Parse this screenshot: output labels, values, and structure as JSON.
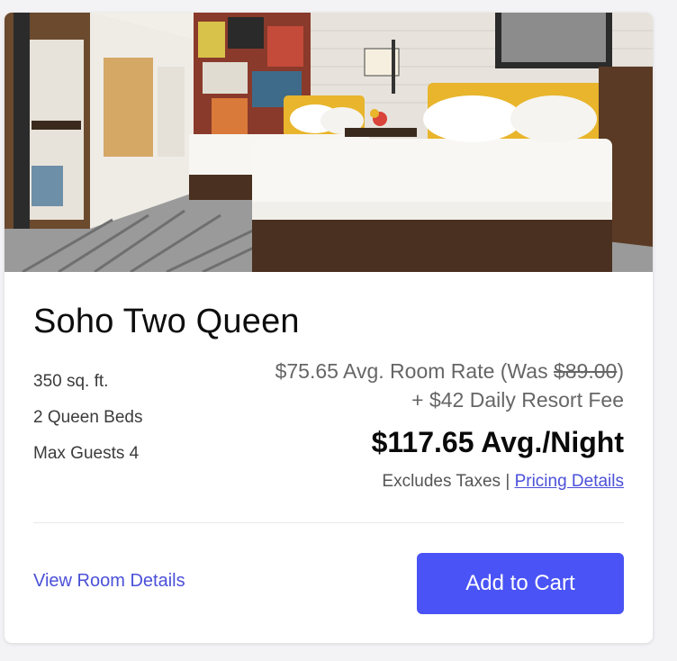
{
  "room": {
    "title": "Soho Two Queen",
    "specs": [
      "350 sq. ft.",
      "2 Queen Beds",
      "Max Guests 4"
    ]
  },
  "pricing": {
    "rate_prefix": "$75.65 Avg. Room Rate (Was ",
    "was_price": "$89.00",
    "rate_suffix": ")",
    "resort_fee": "+ $42 Daily Resort Fee",
    "total": "$117.65 Avg./Night",
    "tax_note": "Excludes Taxes | ",
    "details_link": "Pricing Details"
  },
  "actions": {
    "view_details": "View Room Details",
    "add_to_cart": "Add to Cart"
  },
  "colors": {
    "accent": "#4a53f5",
    "link": "#4b50d8"
  }
}
